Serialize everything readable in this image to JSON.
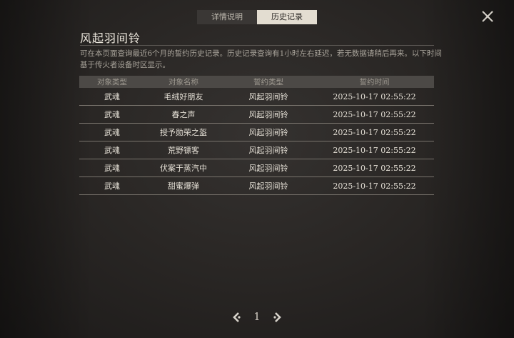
{
  "tabs": [
    {
      "label": "详情说明",
      "active": false
    },
    {
      "label": "历史记录",
      "active": true
    }
  ],
  "title": "风起羽间铃",
  "description": "可在本页面查询最近6个月的誓约历史记录。历史记录查询有1小时左右延迟，若无数据请稍后再来。以下时间基于传火者设备时区显示。",
  "table": {
    "headers": [
      "对象类型",
      "对象名称",
      "誓约类型",
      "誓约时间"
    ],
    "rows": [
      {
        "type": "武魂",
        "name": "毛绒好朋友",
        "pledge": "风起羽间铃",
        "time": "2025-10-17 02:55:22",
        "highlight": false
      },
      {
        "type": "武魂",
        "name": "春之声",
        "pledge": "风起羽间铃",
        "time": "2025-10-17 02:55:22",
        "highlight": false
      },
      {
        "type": "武魂",
        "name": "授予勋荣之盔",
        "pledge": "风起羽间铃",
        "time": "2025-10-17 02:55:22",
        "highlight": true
      },
      {
        "type": "武魂",
        "name": "荒野镖客",
        "pledge": "风起羽间铃",
        "time": "2025-10-17 02:55:22",
        "highlight": false
      },
      {
        "type": "武魂",
        "name": "伏案于蒸汽中",
        "pledge": "风起羽间铃",
        "time": "2025-10-17 02:55:22",
        "highlight": false
      },
      {
        "type": "武魂",
        "name": "甜蜜爆弹",
        "pledge": "风起羽间铃",
        "time": "2025-10-17 02:55:22",
        "highlight": false
      }
    ]
  },
  "pagination": {
    "current": "1"
  },
  "icons": {
    "close": "close-icon",
    "prev": "chevron-left-icon",
    "next": "chevron-right-icon"
  },
  "colors": {
    "highlight_name": "#d08ccf",
    "active_tab": "#e3ddd1"
  }
}
